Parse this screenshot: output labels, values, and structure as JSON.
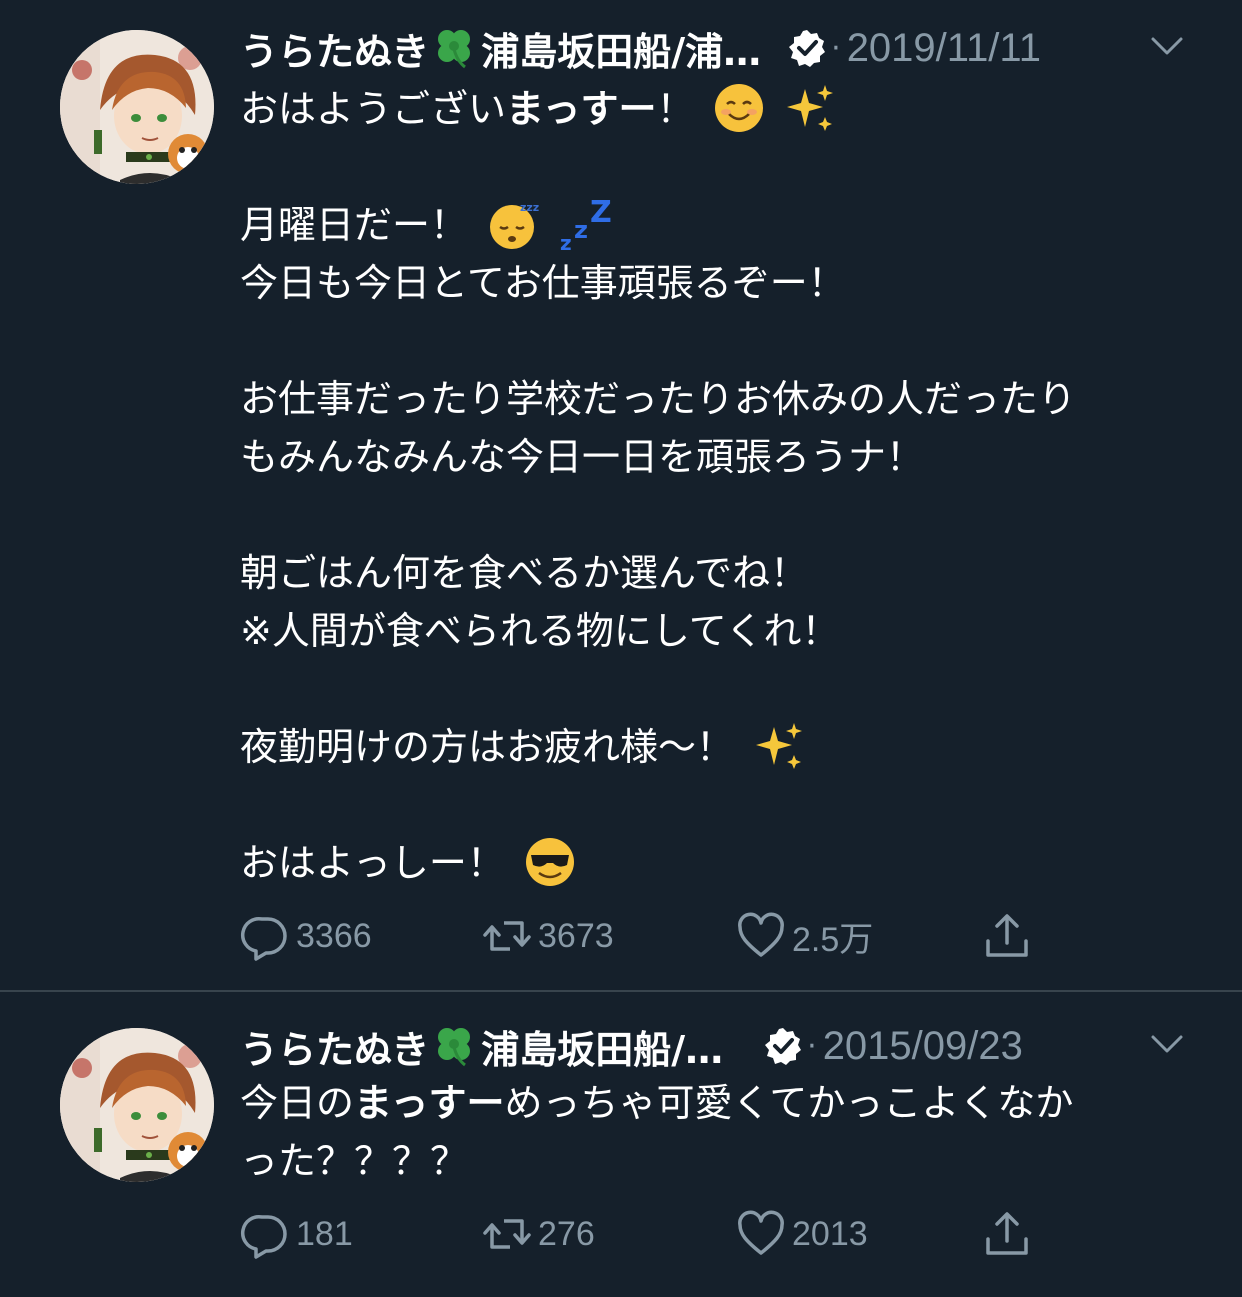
{
  "colors": {
    "background": "#15202b",
    "divider": "#38444d",
    "text_primary": "#ffffff",
    "text_secondary": "#8899a6"
  },
  "tweets": [
    {
      "display_name": "うらたぬき",
      "display_name_suffix": "浦島坂田船/浦…",
      "verified": true,
      "separator": "·",
      "date": "2019/11/11",
      "lines": [
        {
          "text": "おはようござい",
          "bold": "まっすー",
          "tail": "！",
          "emoji": [
            "smiling-face-icon",
            "sparkles-icon"
          ]
        },
        {
          "text": ""
        },
        {
          "text": "月曜日だー！",
          "emoji": [
            "sleeping-face-icon",
            "zzz-icon"
          ]
        },
        {
          "text": "今日も今日とてお仕事頑張るぞー！"
        },
        {
          "text": ""
        },
        {
          "text": "お仕事だったり学校だったりお休みの人だったり"
        },
        {
          "text": "もみんなみんな今日一日を頑張ろうナ！"
        },
        {
          "text": ""
        },
        {
          "text": "朝ごはん何を食べるか選んでね！"
        },
        {
          "text": "※人間が食べられる物にしてくれ！"
        },
        {
          "text": ""
        },
        {
          "text": "夜勤明けの方はお疲れ様〜！",
          "emoji": [
            "sparkles-icon"
          ]
        },
        {
          "text": ""
        },
        {
          "text": "おはよっしー！",
          "emoji": [
            "sunglasses-face-icon"
          ]
        }
      ],
      "actions": {
        "replies": "3366",
        "retweets": "3673",
        "likes": "2.5万",
        "share": ""
      }
    },
    {
      "display_name": "うらたぬき",
      "display_name_suffix": "浦島坂田船/…",
      "verified": true,
      "separator": "·",
      "date": "2015/09/23",
      "lines": [
        {
          "text": "今日の",
          "bold": "まっすー",
          "tail": "めっちゃ可愛くてかっこよくなか"
        },
        {
          "text": "った？？？？"
        }
      ],
      "actions": {
        "replies": "181",
        "retweets": "276",
        "likes": "2013",
        "share": ""
      }
    }
  ]
}
